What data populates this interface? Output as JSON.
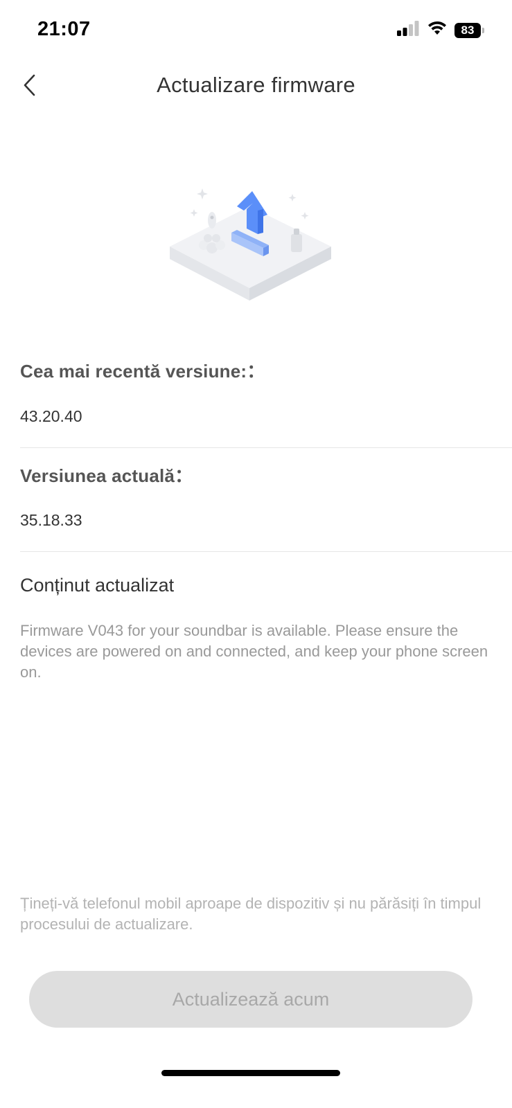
{
  "status_bar": {
    "time": "21:07",
    "battery_level": "83",
    "icons": [
      "cellular-signal-icon",
      "wifi-icon",
      "battery-icon"
    ]
  },
  "header": {
    "title": "Actualizare firmware",
    "back_icon": "chevron-left-icon"
  },
  "illustration": {
    "icon": "firmware-upload-icon",
    "accent_color": "#5b8ff9"
  },
  "latest_version": {
    "label": "Cea mai recentă versiune:：",
    "value": "43.20.40"
  },
  "current_version": {
    "label": "Versiunea actuală：",
    "value": "35.18.33"
  },
  "update_content": {
    "title": "Conținut actualizat",
    "body": "Firmware V043 for your soundbar is available. Please ensure the devices are powered on and connected, and keep your phone screen on."
  },
  "footer": {
    "note": "Țineți-vă telefonul mobil aproape de dispozitiv și nu părăsiți în timpul procesului de actualizare.",
    "button_label": "Actualizează acum",
    "button_enabled": false
  }
}
